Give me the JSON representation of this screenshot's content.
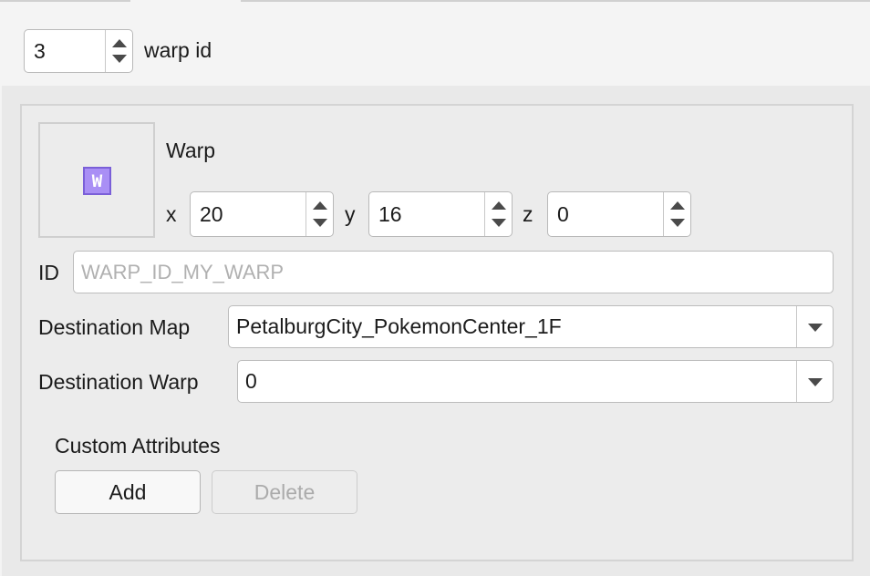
{
  "top": {
    "warp_index": "3",
    "warp_index_label": "warp id"
  },
  "event": {
    "type_label": "Warp",
    "icon_glyph": "W",
    "x_label": "x",
    "x_value": "20",
    "y_label": "y",
    "y_value": "16",
    "z_label": "z",
    "z_value": "0"
  },
  "fields": {
    "id_label": "ID",
    "id_placeholder": "WARP_ID_MY_WARP",
    "dest_map_label": "Destination Map",
    "dest_map_value": "PetalburgCity_PokemonCenter_1F",
    "dest_warp_label": "Destination Warp",
    "dest_warp_value": "0"
  },
  "custom_attributes": {
    "title": "Custom Attributes",
    "add_label": "Add",
    "delete_label": "Delete"
  },
  "colors": {
    "icon_fill": "#a98ff5",
    "disabled_text": "#ababab"
  }
}
